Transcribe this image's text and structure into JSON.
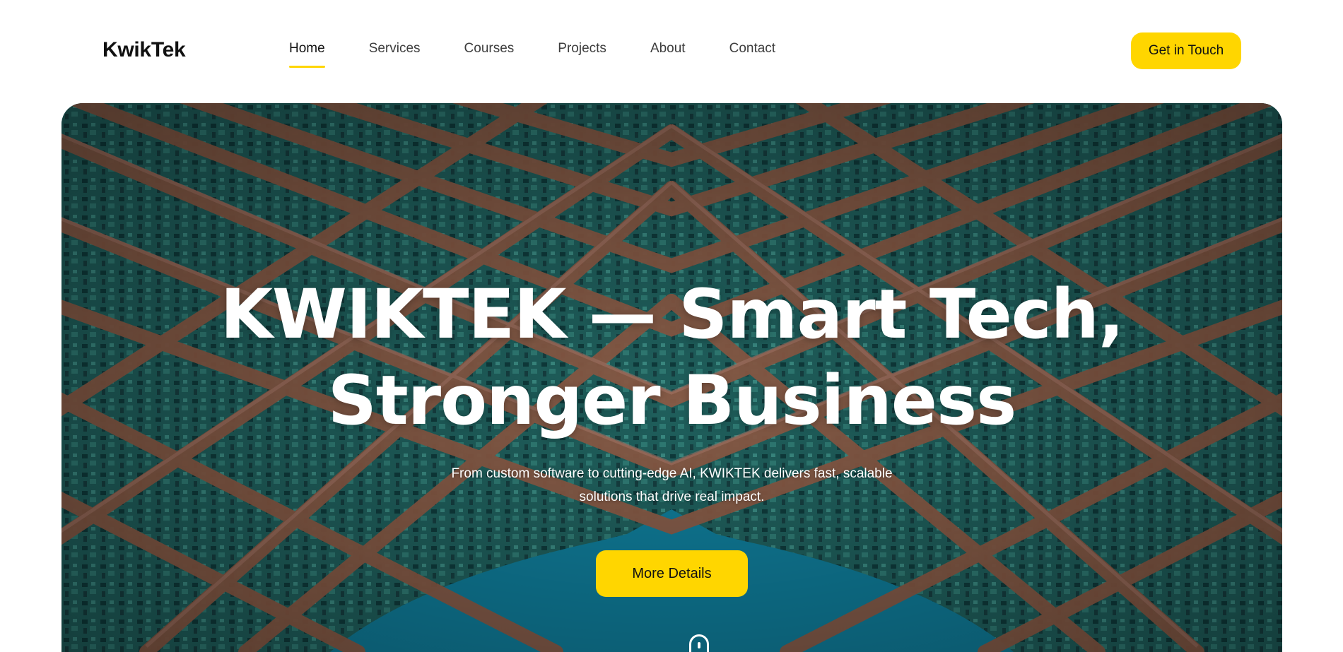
{
  "brand": {
    "name": "KwikTek",
    "accent_color": "#FFD600"
  },
  "nav": {
    "items": [
      {
        "label": "Home",
        "active": true
      },
      {
        "label": "Services",
        "active": false
      },
      {
        "label": "Courses",
        "active": false
      },
      {
        "label": "Projects",
        "active": false
      },
      {
        "label": "About",
        "active": false
      },
      {
        "label": "Contact",
        "active": false
      }
    ],
    "cta_label": "Get in Touch"
  },
  "hero": {
    "title_line1": "KWIKTEK — Smart Tech,",
    "title_line2": "Stronger Business",
    "subtitle_line1": "From custom software to cutting-edge AI, KWIKTEK delivers fast, scalable",
    "subtitle_line2": "solutions that drive real impact.",
    "cta_label": "More Details",
    "scroll_icon": "mouse-scroll-icon",
    "background_colors": {
      "sky": "#0f7b98",
      "stone": "#8a5a45",
      "tile": "#1f5a58"
    }
  }
}
